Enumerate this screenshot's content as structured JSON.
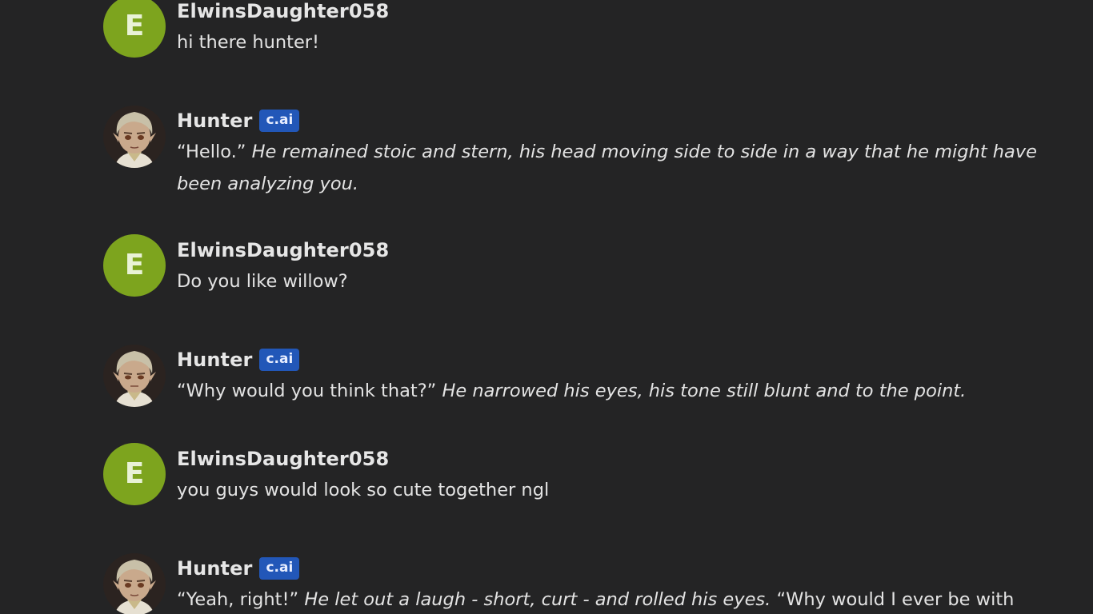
{
  "messages": [
    {
      "author": "ElwinsDaughter058",
      "avatar_letter": "E",
      "text": "hi there hunter!"
    },
    {
      "author": "Hunter",
      "badge": "c.ai",
      "quote": "“Hello.”",
      "action": "He remained stoic and stern, his head moving side to side in a way that he might have been analyzing you."
    },
    {
      "author": "ElwinsDaughter058",
      "avatar_letter": "E",
      "text": "Do you like willow?"
    },
    {
      "author": "Hunter",
      "badge": "c.ai",
      "quote": "“Why would you think that?”",
      "action": "He narrowed his eyes, his tone still blunt and to the point."
    },
    {
      "author": "ElwinsDaughter058",
      "avatar_letter": "E",
      "text": "you guys would look so cute together ngl"
    },
    {
      "author": "Hunter",
      "badge": "c.ai",
      "quote": "“Yeah, right!”",
      "action": "He let out a laugh - short, curt - and rolled his eyes.",
      "quote2": "“Why would I ever be with"
    }
  ],
  "colors": {
    "background": "#242425",
    "user_avatar": "#7da41e",
    "badge": "#2257b8"
  }
}
